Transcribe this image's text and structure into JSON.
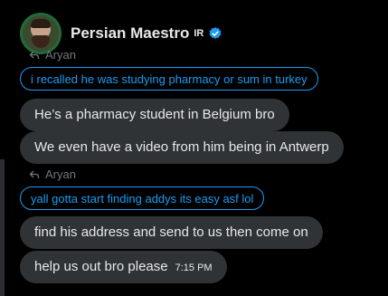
{
  "header": {
    "name": "Persian Maestro",
    "flag": "IR"
  },
  "messages": [
    {
      "reply_to": "Aryan",
      "quote": "i recalled he was studying pharmacy or sum in turkey"
    },
    {
      "text": "He’s a pharmacy student in Belgium bro"
    },
    {
      "text": "We even have a video from him being in Antwerp"
    },
    {
      "reply_to": "Aryan",
      "quote": "yall gotta start finding addys its easy asf lol"
    },
    {
      "text": "find his address and send to us then come on"
    },
    {
      "text": "help us out bro please",
      "time": "7:15 PM"
    }
  ],
  "colors": {
    "background": "#000000",
    "bubble": "#2f3336",
    "accent": "#1d9bf0",
    "muted": "#71767b",
    "text": "#e7e9ea"
  },
  "icons": {
    "verified": "verified-badge-icon",
    "reply": "reply-arrow-icon"
  }
}
